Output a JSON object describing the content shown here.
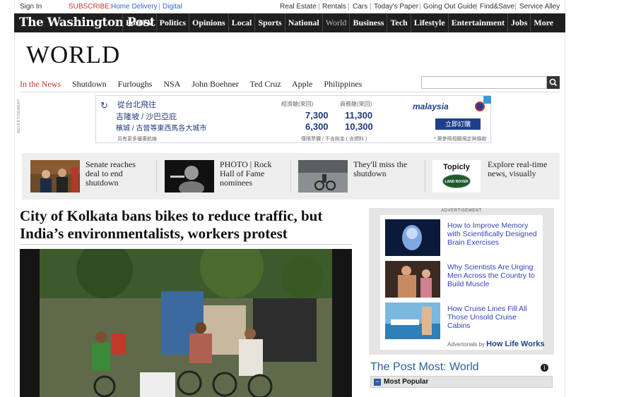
{
  "utility": {
    "sign_in": "Sign In",
    "subscribe": "SUBSCRIBE:",
    "home_delivery": "Home Delivery",
    "digital": "Digital",
    "links": [
      "Real Estate",
      "Rentals",
      "Cars",
      "Today's Paper",
      "Going Out Guide",
      "Find&Save",
      "Service Alley"
    ]
  },
  "nav": {
    "logo": "The Washington Post",
    "items": [
      "PostTV",
      "Politics",
      "Opinions",
      "Local",
      "Sports",
      "National",
      "World",
      "Business",
      "Tech",
      "Lifestyle",
      "Entertainment",
      "Jobs",
      "More"
    ],
    "active": "World"
  },
  "section": {
    "title": "WORLD",
    "in_the_news": "In the News",
    "topics": [
      "Shutdown",
      "Furloughs",
      "NSA",
      "John Boehner",
      "Ted Cruz",
      "Apple",
      "Philippines"
    ]
  },
  "ad_banner": {
    "side_label": "ADVERTISEMENT",
    "from": "從台北飛往",
    "col_economy": "經濟艙(來回)",
    "col_business": "商務艙(來回)",
    "row1_dest": "吉隆坡 / 沙巴亞庇",
    "row1_economy": "7,300",
    "row1_business": "11,300",
    "row2_dest": "檳城 / 古晉等東西馬各大城市",
    "row2_economy": "6,300",
    "row2_business": "10,300",
    "footnote_left": "另有更多優惠航線",
    "footnote_mid": "僅限票價 / 不含稅金 ( 含燃料 )",
    "footnote_right": "* 需參照相關規定與條款",
    "brand": "malaysia",
    "cta": "立即訂購"
  },
  "teasers": [
    {
      "text": "Senate reaches deal to end shutdown"
    },
    {
      "text": "PHOTO | Rock Hall of Fame nominees"
    },
    {
      "text": "They'll miss the shutdown"
    },
    {
      "text": "Explore real-time news, visually",
      "sponsor_label": "Topicly",
      "sponsor_brand": "LAND ROVER"
    }
  ],
  "article": {
    "headline": "City of Kolkata bans bikes to reduce traffic, but India’s environmentalists, workers protest"
  },
  "right_ad": {
    "label": "ADVERTISEMENT",
    "items": [
      {
        "text": "How to Improve Memory with Scientifically Designed Brain Exercises"
      },
      {
        "text": "Why Scientists Are Urging Men Across the Country to Build Muscle"
      },
      {
        "text": "How Cruise Lines Fill All Those Unsold Cruise Cabins"
      }
    ],
    "footer_prefix": "Advertorials by",
    "footer_brand": "How Life Works"
  },
  "most": {
    "title": "The Post Most: World",
    "tab": "Most Popular"
  },
  "colors": {
    "nav_bg": "#1f1f1f",
    "accent_red": "#c0392b",
    "link_blue": "#3344bb",
    "most_title_blue": "#2b5d9e"
  }
}
